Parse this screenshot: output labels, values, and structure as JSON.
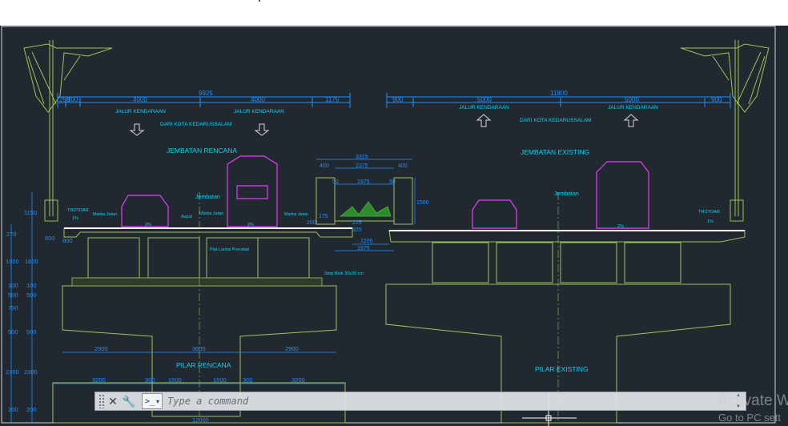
{
  "colors": {
    "background": "#212830",
    "structure": "#9bc45a",
    "dimension": "#1f8fff",
    "text": "#00d8ff",
    "vehicle": "#e040fb",
    "frame": "#d6d9dc",
    "crosshair": "#ffffff"
  },
  "drawing": {
    "dim_left": {
      "total": "9925",
      "segments": [
        "250",
        "800",
        "4000",
        "4000",
        "1175"
      ],
      "labels_jalur": [
        "JALUR KENDARAAN",
        "JALUR KENDARAAN"
      ],
      "direction": "DARI KOTA KEDARUSSALAM",
      "title": "JEMBATAN RENCANA",
      "pier": "PILAR RENCANA"
    },
    "dim_right": {
      "total": "11800",
      "segments": [
        "900",
        "5000",
        "5000",
        "900"
      ],
      "labels_jalur": [
        "JALUR KENDARAAN",
        "JALUR KENDARAAN"
      ],
      "direction": "DARI KOTA KEDARUSSALAM",
      "title": "JEMBATAN EXISTING",
      "pier": "PILAR EXISTING"
    },
    "median": {
      "top": "3325",
      "inner": "2375",
      "a": "400",
      "b": "400",
      "c": "50",
      "d": "50",
      "w": "1975",
      "h": "1500",
      "bottom1": "1200",
      "bottom2": "1975",
      "s1": "175",
      "s2": "225",
      "s3": "325",
      "s4": "200"
    },
    "annotations": {
      "trotoar_l": "TROTOAR",
      "trotoar_r": "TROTOAR",
      "slope_l": "1%",
      "slope_r": "1%",
      "cl_rencana": "Jembatan",
      "cl_existing": "Jembatan",
      "marka1": "Marka Jalan",
      "marka2": "Marka Jalan",
      "marka3": "Marka Jalan",
      "aspal": "Aspal",
      "pelat": "Plat Lantai Precetak",
      "stop_block": "Stop Blok 30x30 cm",
      "pct_l1": "2%",
      "pct_l2": "2%",
      "pct_r": "2%"
    },
    "left_dims": {
      "d1150": "1150",
      "d270": "270",
      "d600": "600",
      "d1600a": "1600",
      "d1600b": "1600",
      "d100a": "100",
      "d100b": "100",
      "d500a": "500",
      "d500b": "500",
      "d750a": "750",
      "d500c": "500",
      "d500d": "500",
      "d2300a": "2300",
      "d2300b": "2300",
      "d200a": "200",
      "d200b": "200",
      "d800": "800"
    },
    "pier_dims": {
      "p2900a": "2900",
      "p3600": "3600",
      "p2900b": "2900",
      "p3200a": "3200",
      "p300a": "300",
      "p1500a": "1500",
      "p1500b": "1500",
      "p300b": "300",
      "p3200b": "3200",
      "p_bottom": "12000"
    }
  },
  "command_line": {
    "placeholder": "Type a command",
    "close_glyph": "✕",
    "settings_glyph": "🔧",
    "prompt_glyph": ">_",
    "dropdown_glyph": "▾",
    "scroll_up": "▲",
    "scroll_down": "▼"
  },
  "watermark": {
    "line1": "Activate W",
    "line2": "Go to PC sett"
  }
}
